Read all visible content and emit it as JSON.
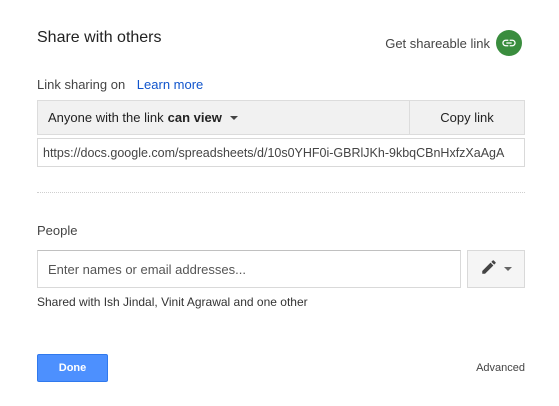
{
  "dialog": {
    "title": "Share with others",
    "get_link_label": "Get shareable link",
    "link_sharing_label": "Link sharing on",
    "learn_more_label": "Learn more",
    "access": {
      "prefix": "Anyone with the link",
      "level": "can view"
    },
    "copy_link_label": "Copy link",
    "share_url": "https://docs.google.com/spreadsheets/d/10s0YHF0i-GBRlJKh-9kbqCBnHxfzXaAgA",
    "people_label": "People",
    "people_placeholder": "Enter names or email addresses...",
    "shared_with_text": "Shared with Ish Jindal, Vinit Agrawal and one other",
    "done_label": "Done",
    "advanced_label": "Advanced"
  },
  "icons": {
    "get_link": "link-icon",
    "access_dropdown": "chevron-down-icon",
    "permission": "pencil-icon",
    "permission_dropdown": "chevron-down-icon"
  },
  "colors": {
    "link_icon_bg": "#3a8d3e",
    "done_button": "#4d90fe",
    "learn_more": "#1155cc"
  }
}
